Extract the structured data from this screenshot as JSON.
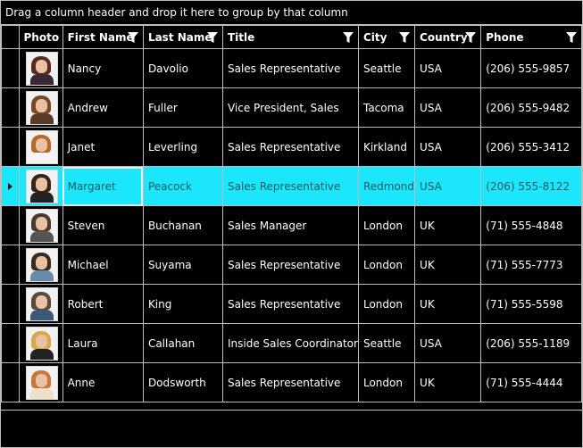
{
  "group_panel": {
    "text": "Drag a column header and drop it here to group by that column"
  },
  "columns": {
    "photo": "Photo",
    "first_name": "First Name",
    "last_name": "Last Name",
    "title": "Title",
    "city": "City",
    "country": "Country",
    "phone": "Phone"
  },
  "rows": [
    {
      "first_name": "Nancy",
      "last_name": "Davolio",
      "title": "Sales Representative",
      "city": "Seattle",
      "country": "USA",
      "phone": "(206) 555-9857",
      "hair": "#5a2a1e",
      "shirt": "#3b2a36"
    },
    {
      "first_name": "Andrew",
      "last_name": "Fuller",
      "title": "Vice President, Sales",
      "city": "Tacoma",
      "country": "USA",
      "phone": "(206) 555-9482",
      "hair": "#7a4a22",
      "shirt": "#5a3b2a"
    },
    {
      "first_name": "Janet",
      "last_name": "Leverling",
      "title": "Sales Representative",
      "city": "Kirkland",
      "country": "USA",
      "phone": "(206) 555-3412",
      "hair": "#b56a2a",
      "shirt": "#f4f4f4"
    },
    {
      "first_name": "Margaret",
      "last_name": "Peacock",
      "title": "Sales Representative",
      "city": "Redmond",
      "country": "USA",
      "phone": "(206) 555-8122",
      "hair": "#3a2218",
      "shirt": "#222222"
    },
    {
      "first_name": "Steven",
      "last_name": "Buchanan",
      "title": "Sales Manager",
      "city": "London",
      "country": "UK",
      "phone": "(71) 555-4848",
      "hair": "#4a3a30",
      "shirt": "#555555"
    },
    {
      "first_name": "Michael",
      "last_name": "Suyama",
      "title": "Sales Representative",
      "city": "London",
      "country": "UK",
      "phone": "(71) 555-7773",
      "hair": "#3a2a20",
      "shirt": "#6a8aaa"
    },
    {
      "first_name": "Robert",
      "last_name": "King",
      "title": "Sales Representative",
      "city": "London",
      "country": "UK",
      "phone": "(71) 555-5598",
      "hair": "#5a4a3a",
      "shirt": "#3a5a7a"
    },
    {
      "first_name": "Laura",
      "last_name": "Callahan",
      "title": "Inside Sales Coordinator",
      "city": "Seattle",
      "country": "USA",
      "phone": "(206) 555-1189",
      "hair": "#d8a84a",
      "shirt": "#222222"
    },
    {
      "first_name": "Anne",
      "last_name": "Dodsworth",
      "title": "Sales Representative",
      "city": "London",
      "country": "UK",
      "phone": "(71) 555-4444",
      "hair": "#c8783a",
      "shirt": "#f0e0c8"
    }
  ],
  "selected_row_index": 3,
  "colors": {
    "selection": "#1be6fb",
    "selected_text": "#0a5c69",
    "grid_line": "#bdbdbd",
    "background": "#000000"
  }
}
